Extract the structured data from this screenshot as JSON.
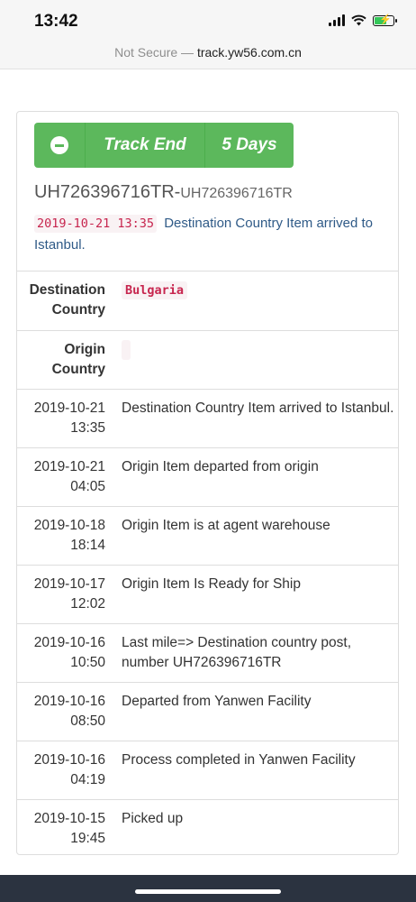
{
  "status": {
    "time": "13:42"
  },
  "browser": {
    "security": "Not Secure —",
    "domain": "track.yw56.com.cn"
  },
  "header": {
    "status_label": "Track End",
    "days_label": "5 Days",
    "tracking_number": "UH726396716TR",
    "tracking_sub": "UH726396716TR",
    "latest_time": "2019-10-21 13:35",
    "latest_text": "Destination Country Item arrived to Istanbul."
  },
  "info": {
    "destination_label": "Destination Country",
    "destination_value": "Bulgaria",
    "origin_label": "Origin Country",
    "origin_value": ""
  },
  "events": [
    {
      "date": "2019-10-21",
      "time": "13:35",
      "text": "Destination Country Item arrived to Istanbul."
    },
    {
      "date": "2019-10-21",
      "time": "04:05",
      "text": "Origin Item departed from origin"
    },
    {
      "date": "2019-10-18",
      "time": "18:14",
      "text": "Origin Item is at agent warehouse"
    },
    {
      "date": "2019-10-17",
      "time": "12:02",
      "text": "Origin Item Is Ready for Ship"
    },
    {
      "date": "2019-10-16",
      "time": "10:50",
      "text": "Last mile=> Destination country post, number UH726396716TR"
    },
    {
      "date": "2019-10-16",
      "time": "08:50",
      "text": "Departed from Yanwen Facility"
    },
    {
      "date": "2019-10-16",
      "time": "04:19",
      "text": "Process completed in Yanwen Facility"
    },
    {
      "date": "2019-10-15",
      "time": "19:45",
      "text": "Picked up"
    }
  ],
  "colors": {
    "success": "#5cb85c",
    "code": "#c7254e",
    "link": "#2f5a87"
  }
}
